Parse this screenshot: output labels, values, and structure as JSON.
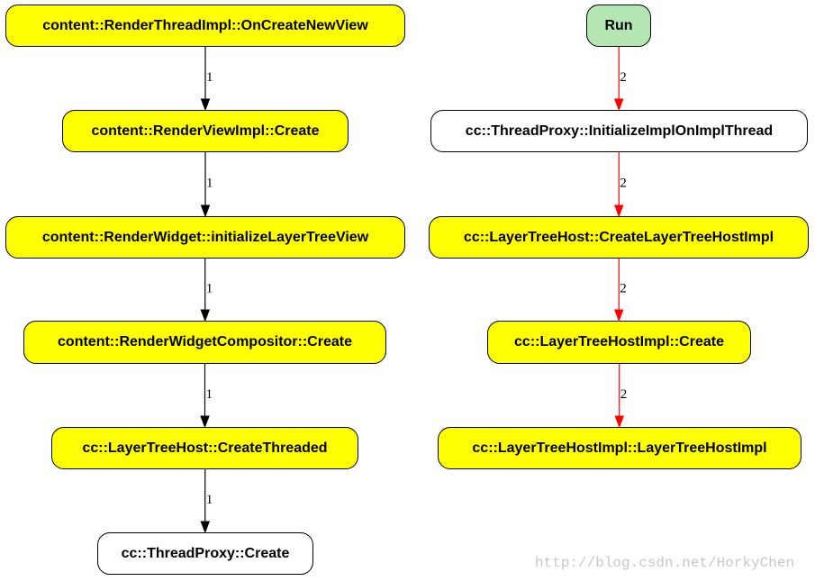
{
  "nodes": {
    "n1": "content::RenderThreadImpl::OnCreateNewView",
    "n2": "content::RenderViewImpl::Create",
    "n3": "content::RenderWidget::initializeLayerTreeView",
    "n4": "content::RenderWidgetCompositor::Create",
    "n5": "cc::LayerTreeHost::CreateThreaded",
    "n6": "cc::ThreadProxy::Create",
    "r0": "Run",
    "r1": "cc::ThreadProxy::InitializeImplOnImplThread",
    "r2": "cc::LayerTreeHost::CreateLayerTreeHostImpl",
    "r3": "cc::LayerTreeHostImpl::Create",
    "r4": "cc::LayerTreeHostImpl::LayerTreeHostImpl"
  },
  "edges": [
    {
      "from": "n1",
      "to": "n2",
      "label": "1",
      "color": "#000000"
    },
    {
      "from": "n2",
      "to": "n3",
      "label": "1",
      "color": "#000000"
    },
    {
      "from": "n3",
      "to": "n4",
      "label": "1",
      "color": "#000000"
    },
    {
      "from": "n4",
      "to": "n5",
      "label": "1",
      "color": "#000000"
    },
    {
      "from": "n5",
      "to": "n6",
      "label": "1",
      "color": "#000000"
    },
    {
      "from": "r0",
      "to": "r1",
      "label": "2",
      "color": "#ff0000"
    },
    {
      "from": "r1",
      "to": "r2",
      "label": "2",
      "color": "#ff0000"
    },
    {
      "from": "r2",
      "to": "r3",
      "label": "2",
      "color": "#ff0000"
    },
    {
      "from": "r3",
      "to": "r4",
      "label": "2",
      "color": "#ff0000"
    }
  ],
  "colors": {
    "default_fill": "#ffff00",
    "entry_fill": "#b3e6b3",
    "leaf_fill": "#ffffff"
  },
  "watermark": "http://blog.csdn.net/HorkyChen"
}
